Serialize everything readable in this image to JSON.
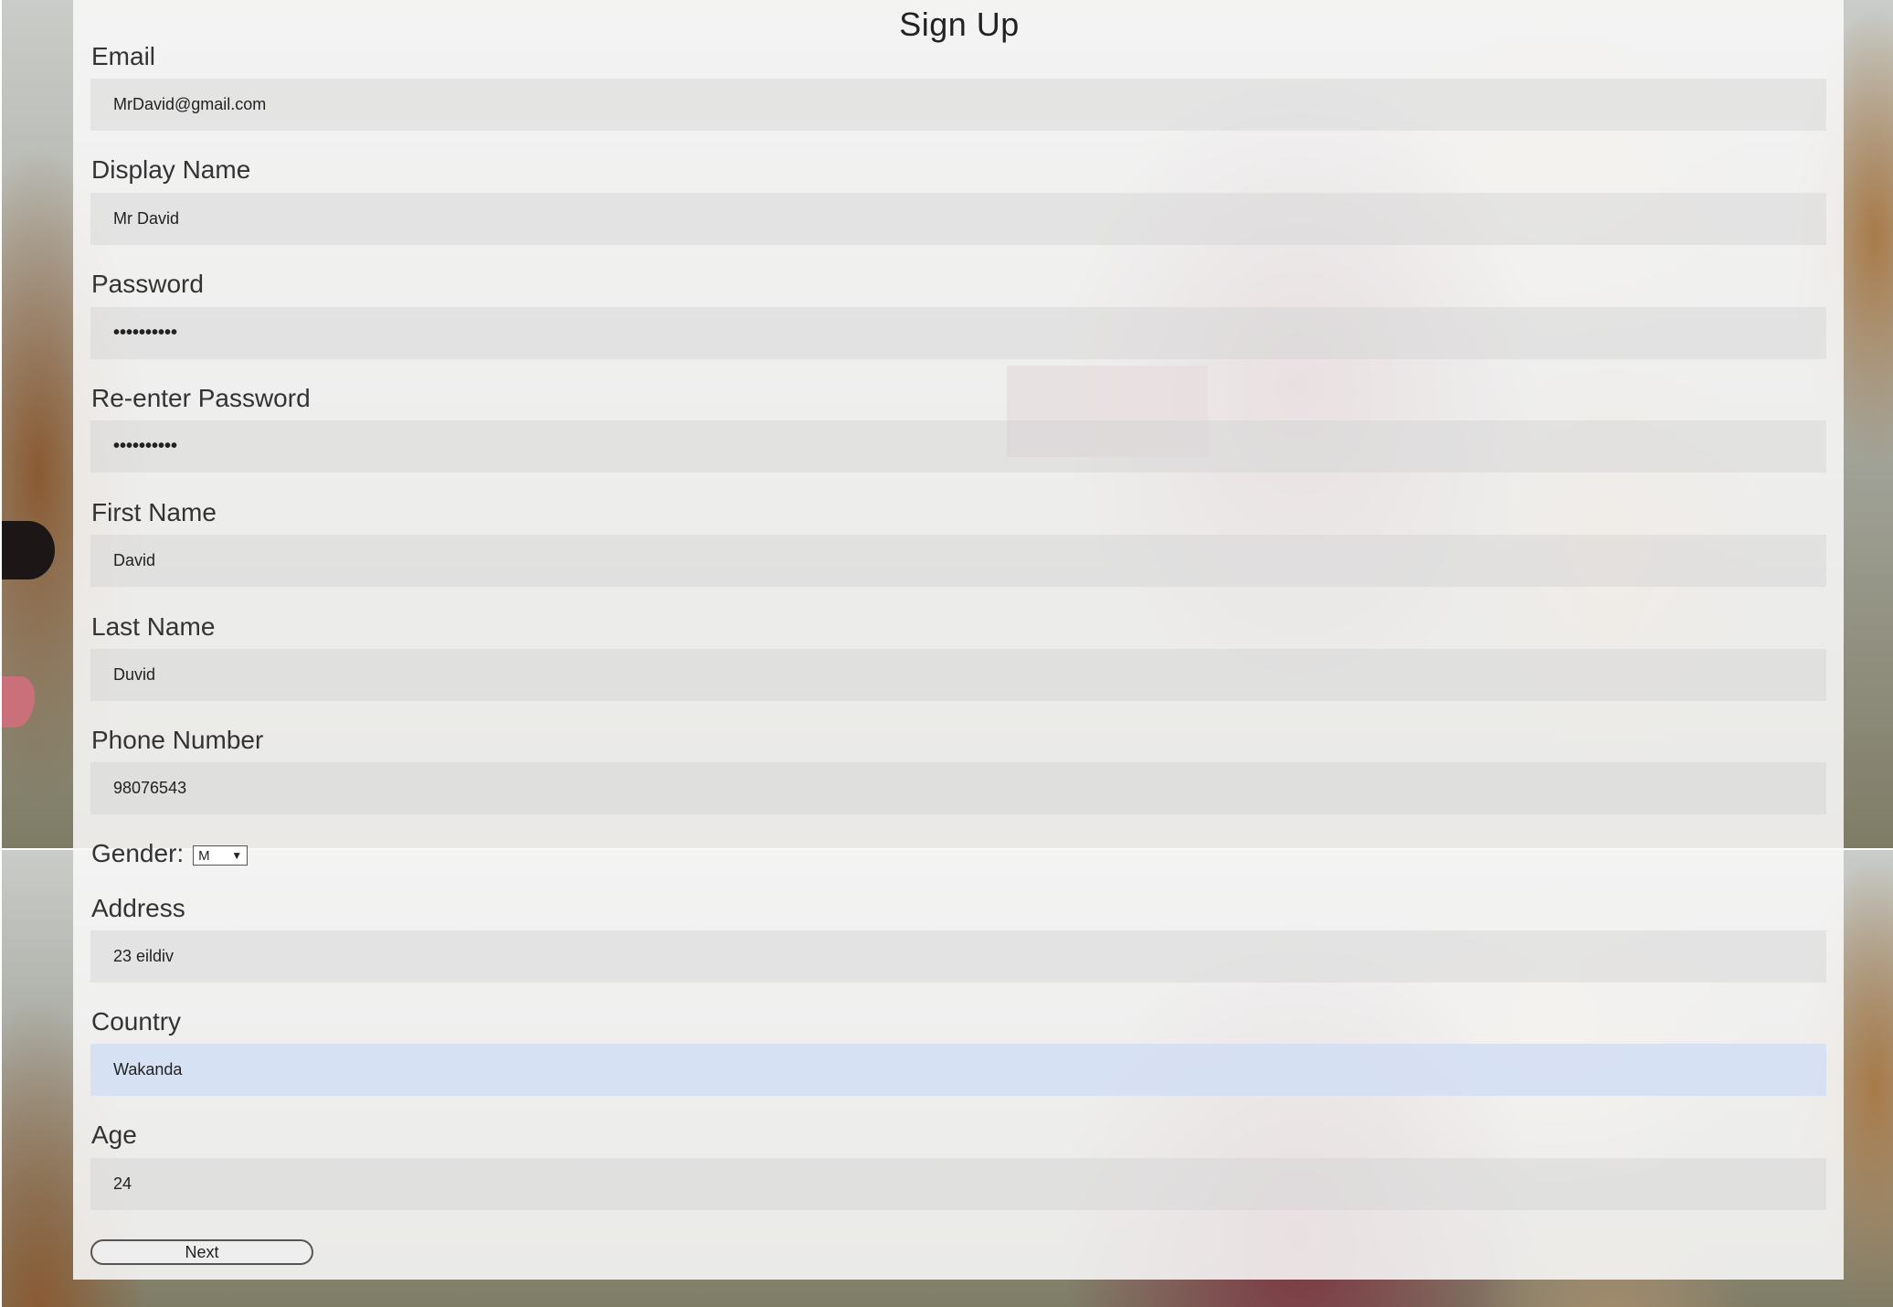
{
  "title": "Sign Up",
  "fields": [
    {
      "label": "Email",
      "value": "MrDavid@gmail.com"
    },
    {
      "label": "Display Name",
      "value": "Mr David"
    },
    {
      "label": "Password",
      "value": "••••••••••"
    },
    {
      "label": "Re-enter Password",
      "value": "••••••••••"
    },
    {
      "label": "First Name",
      "value": "David"
    },
    {
      "label": "Last Name",
      "value": "Duvid"
    },
    {
      "label": "Phone Number",
      "value": "98076543"
    },
    {
      "label": "Address",
      "value": "23 eildiv"
    },
    {
      "label": "Country",
      "value": "Wakanda"
    },
    {
      "label": "Age",
      "value": "24"
    }
  ],
  "gender": {
    "label": "Gender:",
    "selected": "M",
    "chevron": "▼"
  },
  "next_button": {
    "label": "Next"
  },
  "colors": {
    "panel": "#f8f8f8",
    "input_bg": "#e3e3e3",
    "focused_input_bg": "#dde6f4",
    "text": "#333333"
  },
  "icons": {
    "dropdown": "chevron-down-icon"
  }
}
